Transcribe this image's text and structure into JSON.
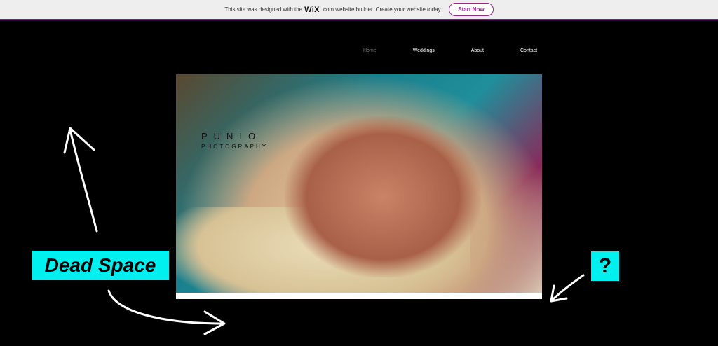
{
  "wix_banner": {
    "text_before": "This site was designed with the",
    "logo": "WiX",
    "text_after": ".com website builder. Create your website today.",
    "cta": "Start Now",
    "accent": "#8c2f8c"
  },
  "nav": {
    "items": [
      "Home",
      "Weddings",
      "About",
      "Contact"
    ],
    "active": "Home"
  },
  "brand": {
    "line1": "PUNIO",
    "line2": "PHOTOGRAPHY"
  },
  "annotations": {
    "dead_space": "Dead Space",
    "question": "?",
    "highlight": "#00f0f0"
  },
  "icons": [
    "arrow-up-annotation-icon",
    "arrow-right-annotation-icon",
    "arrow-down-left-annotation-icon"
  ]
}
